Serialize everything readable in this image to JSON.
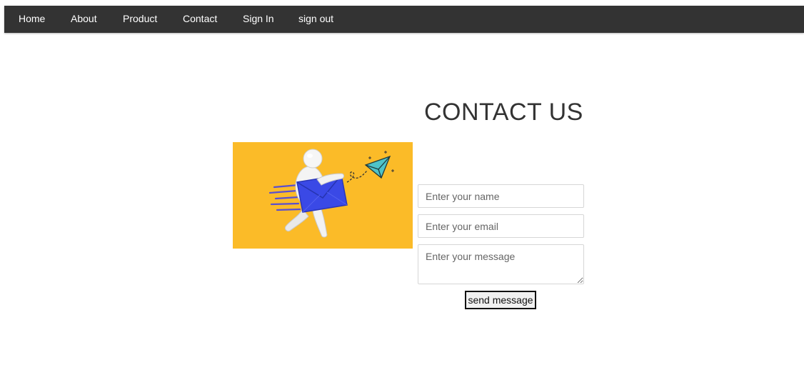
{
  "nav": {
    "items": [
      {
        "label": "Home"
      },
      {
        "label": "About"
      },
      {
        "label": "Product"
      },
      {
        "label": "Contact"
      },
      {
        "label": "Sign In"
      },
      {
        "label": "sign out"
      }
    ]
  },
  "contact": {
    "title": "CONTACT US",
    "name_placeholder": "Enter your name",
    "email_placeholder": "Enter your email",
    "message_placeholder": "Enter your message",
    "send_label": "send message"
  },
  "illustration": {
    "icon": "mail-courier-illustration",
    "background_color": "#fbbb28"
  },
  "colors": {
    "navbar": "#333333",
    "envelope": "#3a49e6",
    "paper_plane": "#4fc3c8"
  }
}
